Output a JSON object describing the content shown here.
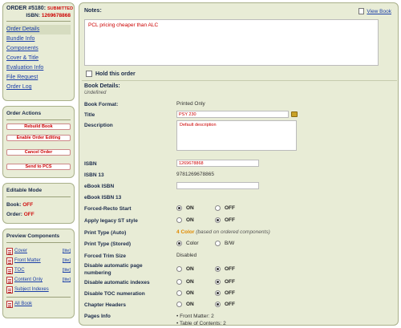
{
  "order": {
    "number_label": "ORDER #5180:",
    "status": "SUBMITTED",
    "isbn_label": "ISBN:",
    "isbn_value": "1269678868"
  },
  "nav": {
    "items": [
      {
        "label": "Order Details"
      },
      {
        "label": "Bundle Info"
      },
      {
        "label": "Components"
      },
      {
        "label": "Cover & Title"
      },
      {
        "label": "Evaluation Info"
      },
      {
        "label": "File Request"
      },
      {
        "label": "Order Log"
      }
    ]
  },
  "actions": {
    "title": "Order Actions",
    "rebuild": "Rebuild Book",
    "enable_editing": "Enable Order Editing",
    "cancel": "Cancel Order",
    "send": "Send to PCS"
  },
  "editable": {
    "title": "Editable Mode",
    "book_label": "Book:",
    "book_value": "OFF",
    "order_label": "Order:",
    "order_value": "OFF"
  },
  "preview": {
    "title": "Preview Components",
    "lite": "[lite]",
    "items": [
      {
        "label": "Cover"
      },
      {
        "label": "Front Matter"
      },
      {
        "label": "TOC"
      },
      {
        "label": "Content Only"
      },
      {
        "label": "Subject Indexes"
      }
    ],
    "all_book": "All Book"
  },
  "main": {
    "notes_label": "Notes:",
    "view_book": "View Book",
    "notes_text": "PCL pricing cheaper than ALC",
    "hold_label": "Hold this order",
    "details_title": "Book Details:",
    "undefined_text": "Undefined"
  },
  "fields": {
    "book_format_label": "Book Format:",
    "book_format_value": "Printed Only",
    "title_label": "Title",
    "title_value": "PSY 230",
    "description_label": "Description",
    "description_value": "Default description",
    "isbn_label": "ISBN",
    "isbn_value": "1269678868",
    "isbn13_label": "ISBN 13",
    "isbn13_value": "9781269678865",
    "ebook_isbn_label": "eBook ISBN",
    "ebook_isbn13_label": "eBook ISBN 13",
    "forced_recto_label": "Forced-Recto Start",
    "legacy_st_label": "Apply legacy ST style",
    "print_type_auto_label": "Print Type (Auto)",
    "print_type_auto_count": "4",
    "print_type_auto_color": "Color",
    "print_type_auto_note": "(based on ordered components)",
    "print_type_stored_label": "Print Type (Stored)",
    "color_option": "Color",
    "bw_option": "B/W",
    "forced_trim_label": "Forced Trim Size",
    "forced_trim_value": "Disabled",
    "disable_page_num_label": "Disable automatic page numbering",
    "disable_indexes_label": "Disable automatic indexes",
    "disable_toc_label": "Disable TOC numeration",
    "chapter_headers_label": "Chapter Headers",
    "pages_info_label": "Pages Info",
    "pages_front_matter": "Front Matter: 2",
    "pages_toc": "Table of Contents: 2",
    "on": "ON",
    "off": "OFF"
  }
}
